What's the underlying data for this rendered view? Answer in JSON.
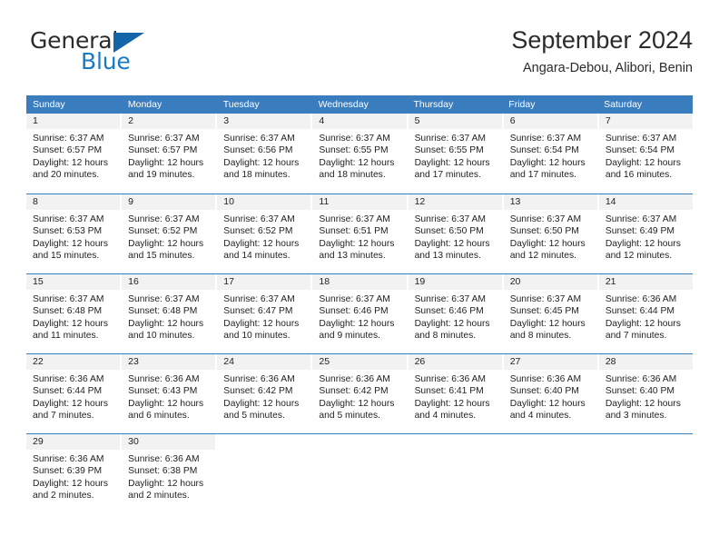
{
  "brand": {
    "name_top": "General",
    "name_bottom": "Blue",
    "triangle_icon": "triangle-icon",
    "accent_color": "#1a7bc4",
    "header_color": "#3a7dbf"
  },
  "header": {
    "title": "September 2024",
    "subtitle": "Angara-Debou, Alibori, Benin"
  },
  "calendar": {
    "weekdays": [
      "Sunday",
      "Monday",
      "Tuesday",
      "Wednesday",
      "Thursday",
      "Friday",
      "Saturday"
    ],
    "weeks": [
      [
        {
          "day": "1",
          "sunrise": "Sunrise: 6:37 AM",
          "sunset": "Sunset: 6:57 PM",
          "daylight1": "Daylight: 12 hours",
          "daylight2": "and 20 minutes."
        },
        {
          "day": "2",
          "sunrise": "Sunrise: 6:37 AM",
          "sunset": "Sunset: 6:57 PM",
          "daylight1": "Daylight: 12 hours",
          "daylight2": "and 19 minutes."
        },
        {
          "day": "3",
          "sunrise": "Sunrise: 6:37 AM",
          "sunset": "Sunset: 6:56 PM",
          "daylight1": "Daylight: 12 hours",
          "daylight2": "and 18 minutes."
        },
        {
          "day": "4",
          "sunrise": "Sunrise: 6:37 AM",
          "sunset": "Sunset: 6:55 PM",
          "daylight1": "Daylight: 12 hours",
          "daylight2": "and 18 minutes."
        },
        {
          "day": "5",
          "sunrise": "Sunrise: 6:37 AM",
          "sunset": "Sunset: 6:55 PM",
          "daylight1": "Daylight: 12 hours",
          "daylight2": "and 17 minutes."
        },
        {
          "day": "6",
          "sunrise": "Sunrise: 6:37 AM",
          "sunset": "Sunset: 6:54 PM",
          "daylight1": "Daylight: 12 hours",
          "daylight2": "and 17 minutes."
        },
        {
          "day": "7",
          "sunrise": "Sunrise: 6:37 AM",
          "sunset": "Sunset: 6:54 PM",
          "daylight1": "Daylight: 12 hours",
          "daylight2": "and 16 minutes."
        }
      ],
      [
        {
          "day": "8",
          "sunrise": "Sunrise: 6:37 AM",
          "sunset": "Sunset: 6:53 PM",
          "daylight1": "Daylight: 12 hours",
          "daylight2": "and 15 minutes."
        },
        {
          "day": "9",
          "sunrise": "Sunrise: 6:37 AM",
          "sunset": "Sunset: 6:52 PM",
          "daylight1": "Daylight: 12 hours",
          "daylight2": "and 15 minutes."
        },
        {
          "day": "10",
          "sunrise": "Sunrise: 6:37 AM",
          "sunset": "Sunset: 6:52 PM",
          "daylight1": "Daylight: 12 hours",
          "daylight2": "and 14 minutes."
        },
        {
          "day": "11",
          "sunrise": "Sunrise: 6:37 AM",
          "sunset": "Sunset: 6:51 PM",
          "daylight1": "Daylight: 12 hours",
          "daylight2": "and 13 minutes."
        },
        {
          "day": "12",
          "sunrise": "Sunrise: 6:37 AM",
          "sunset": "Sunset: 6:50 PM",
          "daylight1": "Daylight: 12 hours",
          "daylight2": "and 13 minutes."
        },
        {
          "day": "13",
          "sunrise": "Sunrise: 6:37 AM",
          "sunset": "Sunset: 6:50 PM",
          "daylight1": "Daylight: 12 hours",
          "daylight2": "and 12 minutes."
        },
        {
          "day": "14",
          "sunrise": "Sunrise: 6:37 AM",
          "sunset": "Sunset: 6:49 PM",
          "daylight1": "Daylight: 12 hours",
          "daylight2": "and 12 minutes."
        }
      ],
      [
        {
          "day": "15",
          "sunrise": "Sunrise: 6:37 AM",
          "sunset": "Sunset: 6:48 PM",
          "daylight1": "Daylight: 12 hours",
          "daylight2": "and 11 minutes."
        },
        {
          "day": "16",
          "sunrise": "Sunrise: 6:37 AM",
          "sunset": "Sunset: 6:48 PM",
          "daylight1": "Daylight: 12 hours",
          "daylight2": "and 10 minutes."
        },
        {
          "day": "17",
          "sunrise": "Sunrise: 6:37 AM",
          "sunset": "Sunset: 6:47 PM",
          "daylight1": "Daylight: 12 hours",
          "daylight2": "and 10 minutes."
        },
        {
          "day": "18",
          "sunrise": "Sunrise: 6:37 AM",
          "sunset": "Sunset: 6:46 PM",
          "daylight1": "Daylight: 12 hours",
          "daylight2": "and 9 minutes."
        },
        {
          "day": "19",
          "sunrise": "Sunrise: 6:37 AM",
          "sunset": "Sunset: 6:46 PM",
          "daylight1": "Daylight: 12 hours",
          "daylight2": "and 8 minutes."
        },
        {
          "day": "20",
          "sunrise": "Sunrise: 6:37 AM",
          "sunset": "Sunset: 6:45 PM",
          "daylight1": "Daylight: 12 hours",
          "daylight2": "and 8 minutes."
        },
        {
          "day": "21",
          "sunrise": "Sunrise: 6:36 AM",
          "sunset": "Sunset: 6:44 PM",
          "daylight1": "Daylight: 12 hours",
          "daylight2": "and 7 minutes."
        }
      ],
      [
        {
          "day": "22",
          "sunrise": "Sunrise: 6:36 AM",
          "sunset": "Sunset: 6:44 PM",
          "daylight1": "Daylight: 12 hours",
          "daylight2": "and 7 minutes."
        },
        {
          "day": "23",
          "sunrise": "Sunrise: 6:36 AM",
          "sunset": "Sunset: 6:43 PM",
          "daylight1": "Daylight: 12 hours",
          "daylight2": "and 6 minutes."
        },
        {
          "day": "24",
          "sunrise": "Sunrise: 6:36 AM",
          "sunset": "Sunset: 6:42 PM",
          "daylight1": "Daylight: 12 hours",
          "daylight2": "and 5 minutes."
        },
        {
          "day": "25",
          "sunrise": "Sunrise: 6:36 AM",
          "sunset": "Sunset: 6:42 PM",
          "daylight1": "Daylight: 12 hours",
          "daylight2": "and 5 minutes."
        },
        {
          "day": "26",
          "sunrise": "Sunrise: 6:36 AM",
          "sunset": "Sunset: 6:41 PM",
          "daylight1": "Daylight: 12 hours",
          "daylight2": "and 4 minutes."
        },
        {
          "day": "27",
          "sunrise": "Sunrise: 6:36 AM",
          "sunset": "Sunset: 6:40 PM",
          "daylight1": "Daylight: 12 hours",
          "daylight2": "and 4 minutes."
        },
        {
          "day": "28",
          "sunrise": "Sunrise: 6:36 AM",
          "sunset": "Sunset: 6:40 PM",
          "daylight1": "Daylight: 12 hours",
          "daylight2": "and 3 minutes."
        }
      ],
      [
        {
          "day": "29",
          "sunrise": "Sunrise: 6:36 AM",
          "sunset": "Sunset: 6:39 PM",
          "daylight1": "Daylight: 12 hours",
          "daylight2": "and 2 minutes."
        },
        {
          "day": "30",
          "sunrise": "Sunrise: 6:36 AM",
          "sunset": "Sunset: 6:38 PM",
          "daylight1": "Daylight: 12 hours",
          "daylight2": "and 2 minutes."
        },
        {
          "day": "",
          "sunrise": "",
          "sunset": "",
          "daylight1": "",
          "daylight2": ""
        },
        {
          "day": "",
          "sunrise": "",
          "sunset": "",
          "daylight1": "",
          "daylight2": ""
        },
        {
          "day": "",
          "sunrise": "",
          "sunset": "",
          "daylight1": "",
          "daylight2": ""
        },
        {
          "day": "",
          "sunrise": "",
          "sunset": "",
          "daylight1": "",
          "daylight2": ""
        },
        {
          "day": "",
          "sunrise": "",
          "sunset": "",
          "daylight1": "",
          "daylight2": ""
        }
      ]
    ]
  }
}
